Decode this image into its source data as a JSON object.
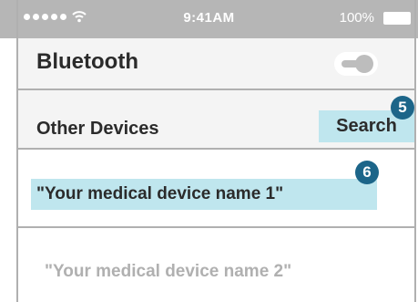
{
  "status_bar": {
    "time": "9:41AM",
    "battery": "100%",
    "signal_icon": "signal-dots-icon",
    "wifi_icon": "wifi-icon",
    "battery_icon": "battery-icon"
  },
  "bluetooth": {
    "label": "Bluetooth",
    "toggle_state": "off"
  },
  "other_devices": {
    "label": "Other Devices",
    "search_label": "Search"
  },
  "devices": [
    {
      "name": "\"Your medical device name 1\"",
      "highlighted": true
    },
    {
      "name": "\"Your medical device name 2\"",
      "highlighted": false
    }
  ],
  "annotations": [
    {
      "number": "5"
    },
    {
      "number": "6"
    }
  ],
  "colors": {
    "status_bar": "#b6b6b6",
    "highlight": "#bfe6ee",
    "badge": "#1c6589",
    "divider": "#b0b0b0",
    "muted_text": "#b0b0b0"
  }
}
